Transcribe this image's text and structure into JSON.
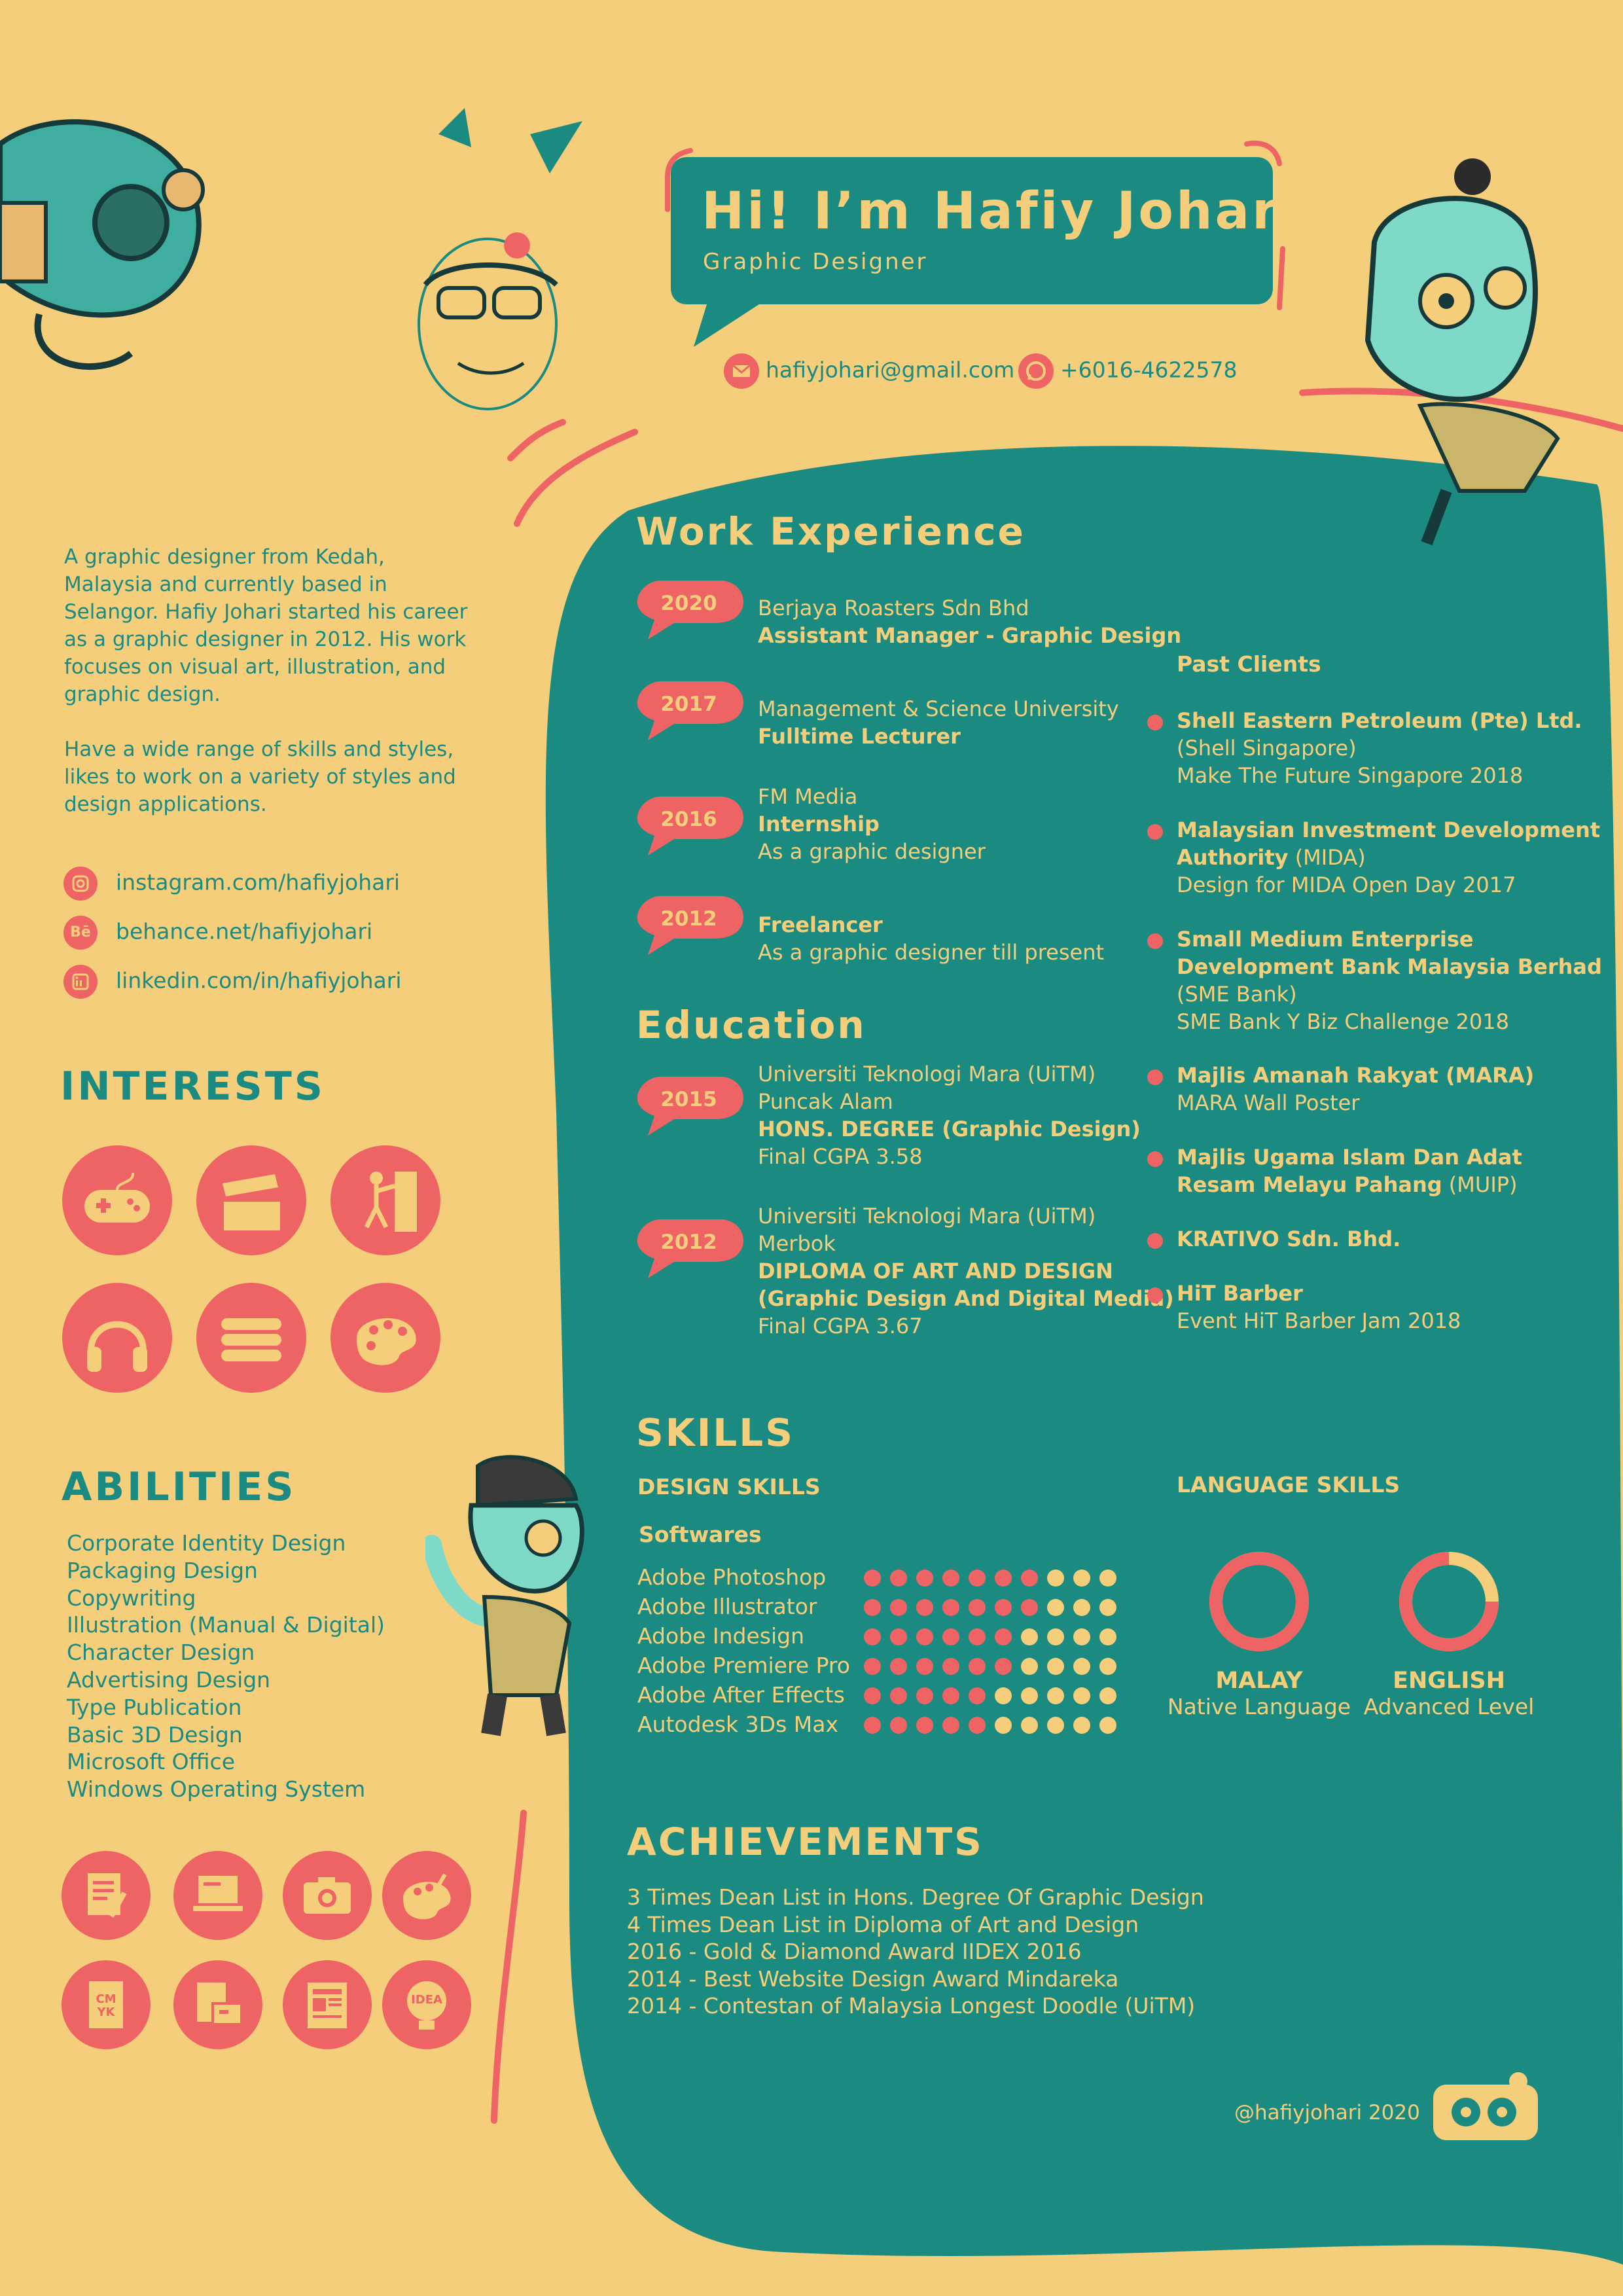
{
  "colors": {
    "background": "#F5CE7B",
    "teal": "#1B8A80",
    "coral": "#EE6464",
    "yellow": "#F5CE7B"
  },
  "header": {
    "name": "Hi! I’m Hafiy Johari",
    "title": "Graphic Designer"
  },
  "contact": {
    "email": "hafiyjohari@gmail.com",
    "phone": "+6016-4622578",
    "email_icon": "mail-icon",
    "phone_icon": "whatsapp-icon"
  },
  "about": {
    "p1": "A graphic designer from Kedah, Malaysia and currently based in Selangor. Hafiy Johari started his career as a graphic designer in 2012. His work focuses on visual art, illustration, and graphic design.",
    "p2": "Have a wide range of skills and styles, likes to work on a variety of styles and design applications."
  },
  "social": [
    {
      "text": "instagram.com/hafiyjohari",
      "icon": "instagram-icon"
    },
    {
      "text": "behance.net/hafiyjohari",
      "icon": "behance-icon",
      "glyph": "Bē"
    },
    {
      "text": "linkedin.com/in/hafiyjohari",
      "icon": "linkedin-icon"
    }
  ],
  "interests": {
    "heading": "INTERESTS",
    "icons": [
      "gamepad-icon",
      "clapperboard-icon",
      "climbing-icon",
      "headphones-icon",
      "books-icon",
      "palette-icon"
    ]
  },
  "abilities": {
    "heading": "ABILITIES",
    "items": [
      "Corporate Identity Design",
      "Packaging Design",
      "Copywriting",
      "Illustration (Manual & Digital)",
      "Character Design",
      "Advertising Design",
      "Type Publication",
      "Basic 3D Design",
      "Microsoft Office",
      "Windows Operating System"
    ],
    "icons": [
      "document-pencil-icon",
      "laptop-icon",
      "camera-icon",
      "palette-icon",
      "cmyk-icon",
      "stationery-icon",
      "magazine-icon",
      "idea-bulb-icon"
    ],
    "cmyk_glyph": "CM YK",
    "idea_glyph": "IDEA"
  },
  "work": {
    "heading": "Work Experience",
    "entries": [
      {
        "year": "2020",
        "company": "Berjaya Roasters Sdn Bhd",
        "role": "Assistant Manager - Graphic Design",
        "note": ""
      },
      {
        "year": "2017",
        "company": "Management & Science University",
        "role": "Fulltime Lecturer",
        "note": ""
      },
      {
        "year": "2016",
        "company": "FM Media",
        "role": "Internship",
        "note": "As a graphic designer"
      },
      {
        "year": "2012",
        "company": "",
        "role": "Freelancer",
        "note": "As a graphic designer till present"
      }
    ]
  },
  "education": {
    "heading": "Education",
    "entries": [
      {
        "year": "2015",
        "school": "Universiti Teknologi Mara (UiTM)",
        "campus": "Puncak Alam",
        "degree": "HONS. DEGREE (Graphic Design)",
        "degree2": "",
        "cgpa": "Final CGPA 3.58"
      },
      {
        "year": "2012",
        "school": "Universiti Teknologi Mara (UiTM)",
        "campus": "Merbok",
        "degree": "DIPLOMA OF ART AND DESIGN",
        "degree2": "(Graphic Design And Digital Media)",
        "cgpa": "Final CGPA 3.67"
      }
    ]
  },
  "clients": {
    "heading": "Past Clients",
    "items": [
      {
        "lines": [
          {
            "t": "Shell Eastern Petroleum (Pte) Ltd.",
            "b": true
          },
          {
            "t": "(Shell Singapore)",
            "b": false
          },
          {
            "t": "Make The Future Singapore 2018",
            "b": false
          }
        ]
      },
      {
        "lines": [
          {
            "t": "Malaysian Investment Development",
            "b": true
          },
          {
            "t": "Authority",
            "b": true,
            "suffix": " (MIDA)"
          },
          {
            "t": "Design for MIDA Open Day 2017",
            "b": false
          }
        ]
      },
      {
        "lines": [
          {
            "t": "Small Medium Enterprise",
            "b": true
          },
          {
            "t": "Development Bank Malaysia Berhad",
            "b": true
          },
          {
            "t": "(SME Bank)",
            "b": false
          },
          {
            "t": "SME Bank Y Biz Challenge 2018",
            "b": false
          }
        ]
      },
      {
        "lines": [
          {
            "t": "Majlis Amanah Rakyat (MARA)",
            "b": true
          },
          {
            "t": "MARA Wall Poster",
            "b": false
          }
        ]
      },
      {
        "lines": [
          {
            "t": "Majlis Ugama Islam Dan Adat",
            "b": true
          },
          {
            "t": "Resam Melayu Pahang",
            "b": true,
            "suffix": " (MUIP)"
          }
        ]
      },
      {
        "lines": [
          {
            "t": "KRATIVO Sdn. Bhd.",
            "b": true
          }
        ]
      },
      {
        "lines": [
          {
            "t": "HiT Barber",
            "b": true
          },
          {
            "t": "Event HiT Barber Jam 2018",
            "b": false
          }
        ]
      }
    ]
  },
  "skills": {
    "heading": "SKILLS",
    "design_heading": "DESIGN SKILLS",
    "software_heading": "Softwares",
    "software": [
      {
        "name": "Adobe Photoshop",
        "level": 7
      },
      {
        "name": "Adobe Illustrator",
        "level": 7
      },
      {
        "name": "Adobe Indesign",
        "level": 6
      },
      {
        "name": "Adobe Premiere Pro",
        "level": 6
      },
      {
        "name": "Adobe After Effects",
        "level": 5
      },
      {
        "name": "Autodesk 3Ds Max",
        "level": 5
      }
    ],
    "max_level": 10,
    "language_heading": "LANGUAGE SKILLS",
    "languages": [
      {
        "name": "MALAY",
        "level_text": "Native Language",
        "fraction": 1.0
      },
      {
        "name": "ENGLISH",
        "level_text": "Advanced Level",
        "fraction": 0.75
      }
    ]
  },
  "achievements": {
    "heading": "ACHIEVEMENTS",
    "items": [
      "3 Times Dean List in Hons. Degree Of Graphic Design",
      "4 Times Dean List in Diploma of Art and Design",
      "2016 - Gold & Diamond Award IIDEX 2016",
      "2014 - Best Website Design Award Mindareka",
      "2014 - Contestan of Malaysia Longest Doodle (UiTM)"
    ]
  },
  "footer": {
    "text": "@hafiyjohari 2020"
  }
}
